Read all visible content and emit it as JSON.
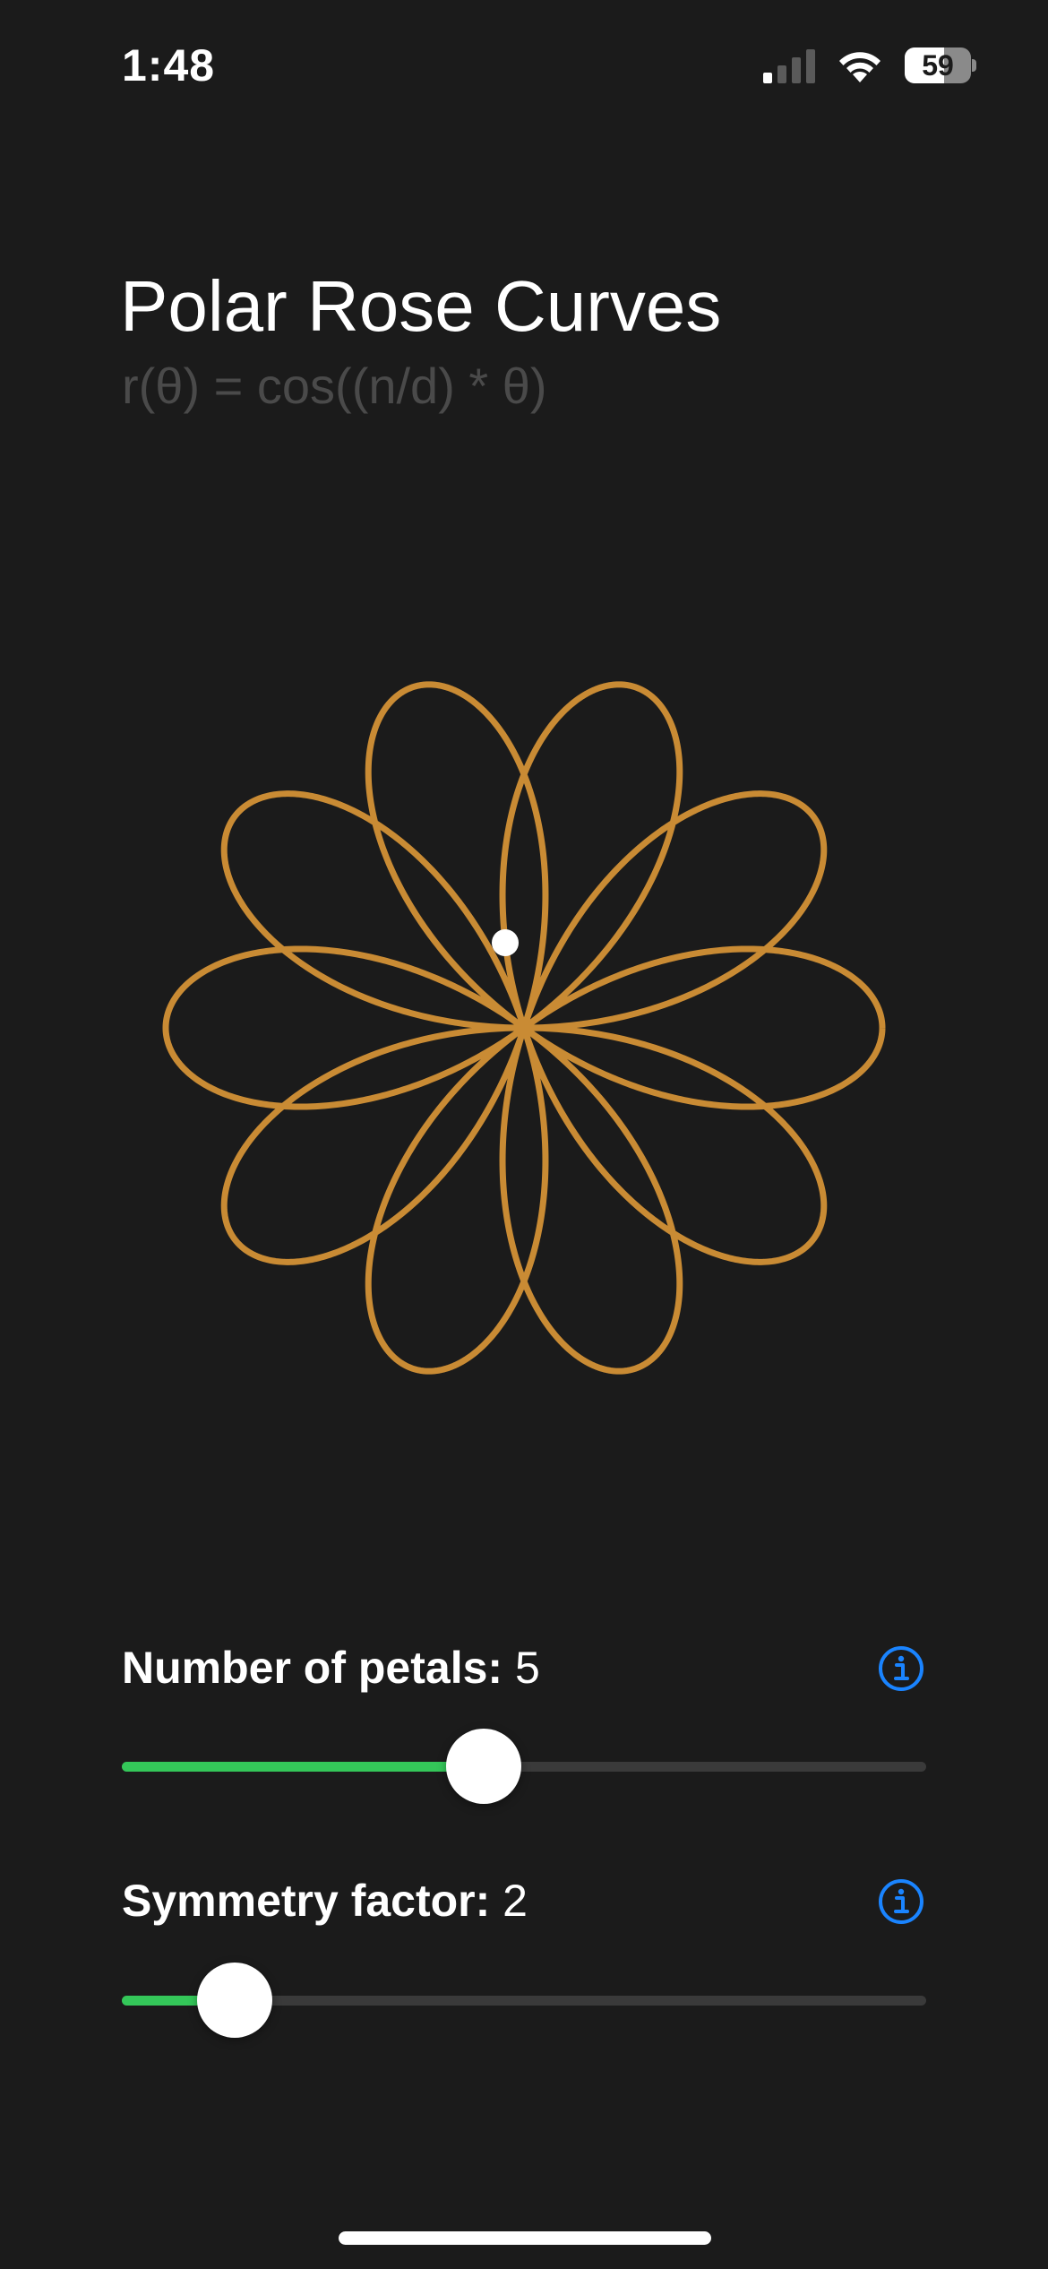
{
  "status_bar": {
    "time": "1:48",
    "battery_level": "59",
    "icons": [
      "cellular-signal-icon",
      "wifi-icon",
      "battery-icon"
    ]
  },
  "header": {
    "title": "Polar Rose Curves",
    "formula": "r(θ) = cos((n/d) * θ)"
  },
  "rose": {
    "n": 5,
    "d": 2,
    "curve_color": "#c98b34",
    "tracer_color": "#ffffff"
  },
  "controls": {
    "petals": {
      "name": "Number of petals:",
      "value": "5",
      "fraction": 0.45,
      "info_icon": "info-circle-icon"
    },
    "symmetry": {
      "name": "Symmetry factor:",
      "value": "2",
      "fraction": 0.14,
      "info_icon": "info-circle-icon"
    }
  },
  "colors": {
    "background": "#1b1b1b",
    "accent_green": "#34c759",
    "info_blue": "#1a84ff",
    "formula_gray": "#4a4a4a",
    "track_gray": "#3a3a3a"
  }
}
